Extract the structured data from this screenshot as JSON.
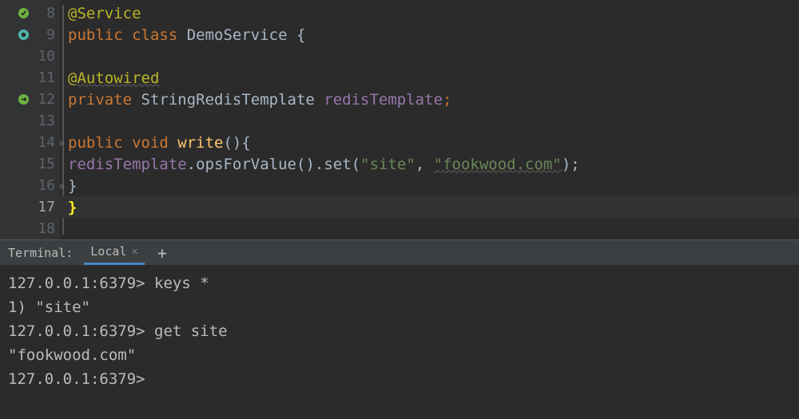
{
  "editor": {
    "lines": [
      {
        "n": 8,
        "icon": "leaf-check"
      },
      {
        "n": 9,
        "icon": "leaf-blue"
      },
      {
        "n": 10
      },
      {
        "n": 11
      },
      {
        "n": 12,
        "icon": "bean-arrow"
      },
      {
        "n": 13
      },
      {
        "n": 14
      },
      {
        "n": 15
      },
      {
        "n": 16
      },
      {
        "n": 17,
        "hl": true
      },
      {
        "n": 18
      }
    ],
    "code": {
      "l8_annotation": "@Service",
      "l9_kw1": "public ",
      "l9_kw2": "class ",
      "l9_cls": "DemoService ",
      "l9_brace": "{",
      "l11_annotation": "@Autowired",
      "l12_kw": "private ",
      "l12_type": "StringRedisTemplate ",
      "l12_field": "redisTemplate",
      "l12_semi": ";",
      "l14_kw1": "public ",
      "l14_kw2": "void ",
      "l14_method": "write",
      "l14_rest": "(){",
      "l15_recv": "redisTemplate",
      "l15_dot1": ".",
      "l15_m1": "opsForValue",
      "l15_paren1": "().",
      "l15_m2": "set",
      "l15_open": "(",
      "l15_s1": "\"site\"",
      "l15_comma": ", ",
      "l15_s2": "\"fookwood.com\"",
      "l15_close": ");",
      "l16_brace": "}",
      "l17_brace": "}"
    }
  },
  "terminal": {
    "label": "Terminal:",
    "tab": "Local",
    "lines": [
      "127.0.0.1:6379> keys *",
      "1) \"site\"",
      "127.0.0.1:6379> get site",
      "\"fookwood.com\"",
      "127.0.0.1:6379>"
    ]
  }
}
